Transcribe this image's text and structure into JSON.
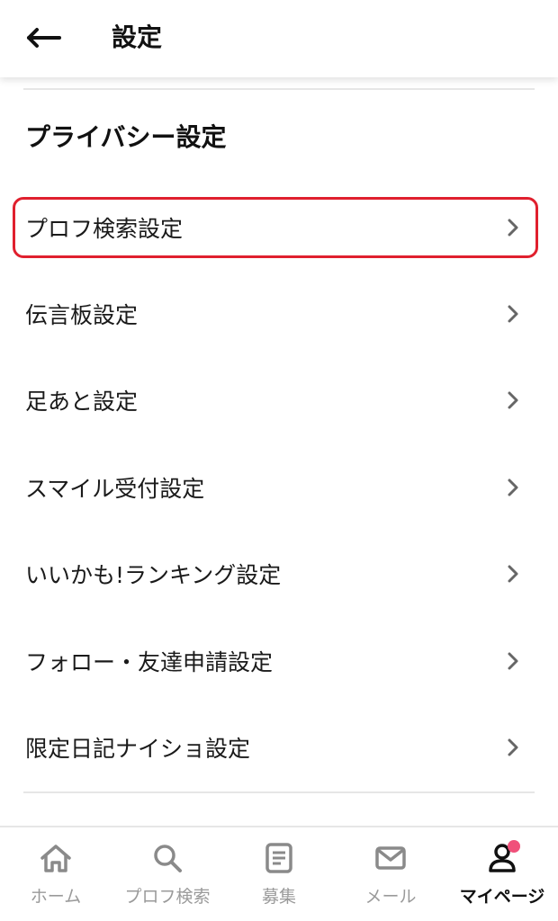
{
  "header": {
    "title": "設定"
  },
  "section": {
    "title": "プライバシー設定"
  },
  "menu": {
    "items": [
      {
        "label": "プロフ検索設定"
      },
      {
        "label": "伝言板設定"
      },
      {
        "label": "足あと設定"
      },
      {
        "label": "スマイル受付設定"
      },
      {
        "label": "いいかも!ランキング設定"
      },
      {
        "label": "フォロー・友達申請設定"
      },
      {
        "label": "限定日記ナイショ設定"
      }
    ],
    "highlight_color": "#e0202e"
  },
  "bottom_nav": {
    "items": [
      {
        "label": "ホーム",
        "icon": "home-icon"
      },
      {
        "label": "プロフ検索",
        "icon": "search-icon"
      },
      {
        "label": "募集",
        "icon": "document-icon"
      },
      {
        "label": "メール",
        "icon": "mail-icon"
      },
      {
        "label": "マイページ",
        "icon": "person-icon"
      }
    ],
    "active_index": 4,
    "notification_dot_color": "#f0507a"
  }
}
